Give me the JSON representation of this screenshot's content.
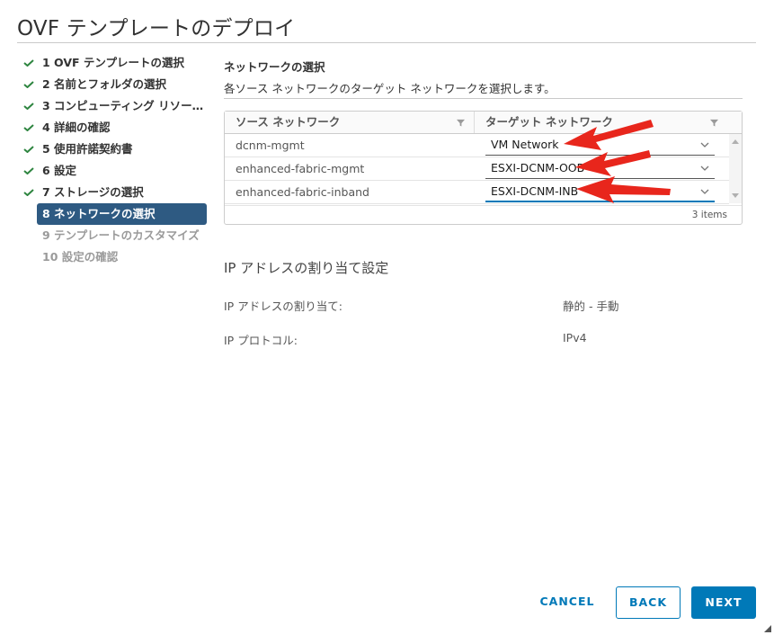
{
  "dialog": {
    "title": "OVF テンプレートのデプロイ"
  },
  "steps": [
    {
      "label": "1 OVF テンプレートの選択",
      "state": "done"
    },
    {
      "label": "2 名前とフォルダの選択",
      "state": "done"
    },
    {
      "label": "3 コンピューティング リソー…",
      "state": "done"
    },
    {
      "label": "4 詳細の確認",
      "state": "done"
    },
    {
      "label": "5 使用許諾契約書",
      "state": "done"
    },
    {
      "label": "6 設定",
      "state": "done"
    },
    {
      "label": "7 ストレージの選択",
      "state": "done"
    },
    {
      "label": "8 ネットワークの選択",
      "state": "active"
    },
    {
      "label": "9 テンプレートのカスタマイズ",
      "state": "todo"
    },
    {
      "label": "10 設定の確認",
      "state": "todo"
    }
  ],
  "network": {
    "title": "ネットワークの選択",
    "description": "各ソース ネットワークのターゲット ネットワークを選択します。",
    "columns": {
      "source": "ソース ネットワーク",
      "target": "ターゲット ネットワーク"
    },
    "rows": [
      {
        "source": "dcnm-mgmt",
        "target": "VM Network"
      },
      {
        "source": "enhanced-fabric-mgmt",
        "target": "ESXI-DCNM-OOB"
      },
      {
        "source": "enhanced-fabric-inband",
        "target": "ESXI-DCNM-INB"
      }
    ],
    "footer": "3 items"
  },
  "ip": {
    "title": "IP アドレスの割り当て設定",
    "allocation_label": "IP アドレスの割り当て:",
    "allocation_value": "静的 - 手動",
    "protocol_label": "IP プロトコル:",
    "protocol_value": "IPv4"
  },
  "buttons": {
    "cancel": "CANCEL",
    "back": "BACK",
    "next": "NEXT"
  },
  "colors": {
    "accent": "#0079b8",
    "active_step": "#2e5a82",
    "check": "#2e8540",
    "annotation_arrow": "#e8261c"
  },
  "icons": {
    "check": "check-icon",
    "filter": "filter-icon",
    "chevron": "chevron-down-icon",
    "arrow": "red-arrow-annotation"
  }
}
